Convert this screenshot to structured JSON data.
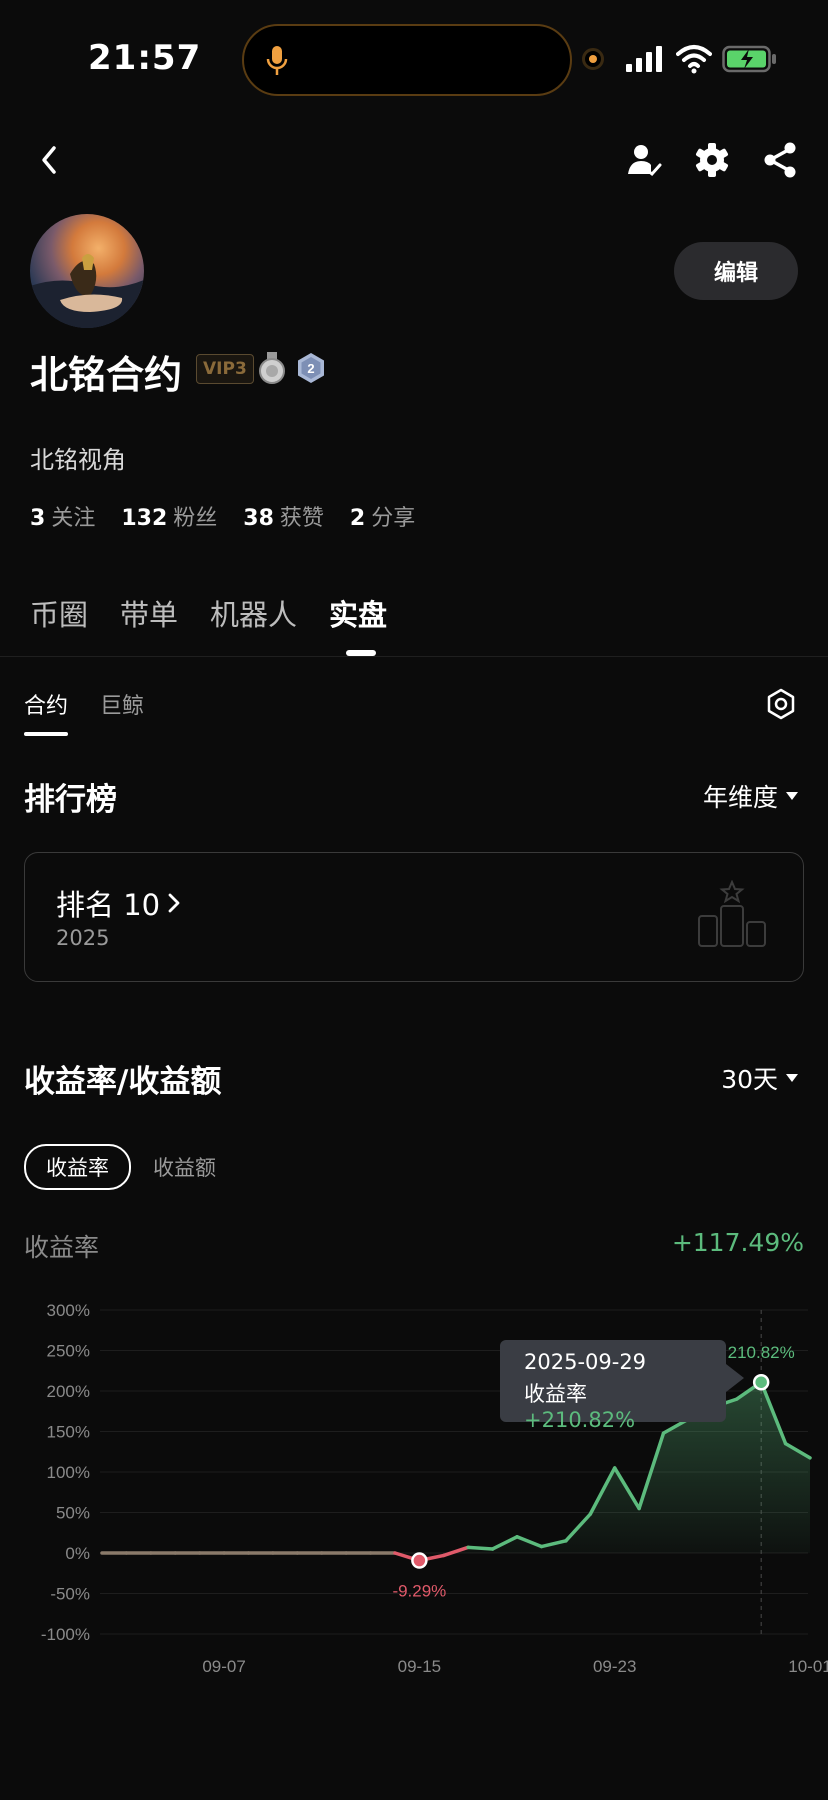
{
  "status_bar": {
    "time": "21:57"
  },
  "header": {
    "icons": [
      "back-icon",
      "user-check-icon",
      "gear-icon",
      "share-icon"
    ]
  },
  "profile": {
    "name": "北铭合约",
    "vip": "VIP3",
    "medal_level": "2",
    "bio": "北铭视角",
    "edit_label": "编辑",
    "stats": [
      {
        "num": "3",
        "label": "关注"
      },
      {
        "num": "132",
        "label": "粉丝"
      },
      {
        "num": "38",
        "label": "获赞"
      },
      {
        "num": "2",
        "label": "分享"
      }
    ]
  },
  "main_tabs": [
    "币圈",
    "带单",
    "机器人",
    "实盘"
  ],
  "main_tab_active": "实盘",
  "sub_tabs": [
    "合约",
    "巨鲸"
  ],
  "ranking": {
    "title": "排行榜",
    "period": "年维度",
    "rank_label": "排名 10",
    "year": "2025"
  },
  "returns": {
    "title": "收益率/收益额",
    "period": "30天",
    "toggle_active": "收益率",
    "toggle_other": "收益额",
    "metric_label": "收益率",
    "metric_value": "+117.49%",
    "tooltip_date": "2025-09-29",
    "tooltip_label": "收益率",
    "tooltip_value": "+210.82%"
  },
  "colors": {
    "positive": "#5cbb7d",
    "negative": "#e05a6a",
    "bg": "#0b0b0b"
  },
  "chart_data": {
    "type": "line",
    "y_ticks": [
      "300%",
      "250%",
      "200%",
      "150%",
      "100%",
      "50%",
      "0%",
      "-50%",
      "-100%"
    ],
    "ylim": [
      -100,
      300
    ],
    "x_ticks": [
      "09-07",
      "09-15",
      "09-23",
      "10-01"
    ],
    "series": [
      {
        "values": [
          {
            "x": "09-02",
            "y": 0
          },
          {
            "x": "09-03",
            "y": 0
          },
          {
            "x": "09-04",
            "y": 0
          },
          {
            "x": "09-05",
            "y": 0
          },
          {
            "x": "09-06",
            "y": 0
          },
          {
            "x": "09-07",
            "y": 0
          },
          {
            "x": "09-08",
            "y": 0
          },
          {
            "x": "09-09",
            "y": 0
          },
          {
            "x": "09-10",
            "y": 0
          },
          {
            "x": "09-11",
            "y": 0
          },
          {
            "x": "09-12",
            "y": 0
          },
          {
            "x": "09-13",
            "y": 0
          },
          {
            "x": "09-14",
            "y": 0
          },
          {
            "x": "09-15",
            "y": -9.29
          },
          {
            "x": "09-16",
            "y": -3
          },
          {
            "x": "09-17",
            "y": 7
          },
          {
            "x": "09-18",
            "y": 5
          },
          {
            "x": "09-19",
            "y": 20
          },
          {
            "x": "09-20",
            "y": 8
          },
          {
            "x": "09-21",
            "y": 15
          },
          {
            "x": "09-22",
            "y": 48
          },
          {
            "x": "09-23",
            "y": 105
          },
          {
            "x": "09-24",
            "y": 55
          },
          {
            "x": "09-25",
            "y": 148
          },
          {
            "x": "09-26",
            "y": 165
          },
          {
            "x": "09-27",
            "y": 180
          },
          {
            "x": "09-28",
            "y": 190
          },
          {
            "x": "09-29",
            "y": 210.82
          },
          {
            "x": "09-30",
            "y": 135
          },
          {
            "x": "10-01",
            "y": 117.49
          }
        ]
      }
    ],
    "annotations": [
      {
        "x": "09-15",
        "text": "-9.29%"
      },
      {
        "x": "09-29",
        "text": "210.82%"
      }
    ]
  }
}
